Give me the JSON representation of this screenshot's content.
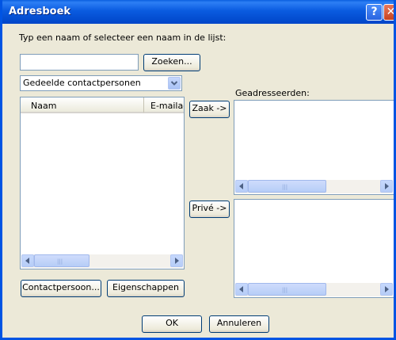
{
  "window": {
    "title": "Adresboek",
    "help_label": "?",
    "close_label": "✕"
  },
  "search": {
    "prompt": "Typ een naam of selecteer een naam in de lijst:",
    "value": "",
    "find_button": "Zoeken..."
  },
  "address_source": {
    "selected": "Gedeelde contactpersonen"
  },
  "contacts_list": {
    "columns": [
      "Naam",
      "E-mailad"
    ],
    "rows": []
  },
  "recipients": {
    "label": "Geadresseerden:",
    "to_button": "Zaak ->",
    "cc_button": "Privé ->"
  },
  "buttons": {
    "contact": "Contactpersoon...",
    "properties": "Eigenschappen",
    "ok": "OK",
    "cancel": "Annuleren"
  },
  "colors": {
    "titlebar": "#0054e3",
    "dialog_bg": "#ece9d8",
    "field_border": "#7f9db9",
    "button_border": "#003c74"
  },
  "icons": {
    "help": "question-mark",
    "close": "x",
    "dropdown": "chevron-down",
    "scroll_left": "triangle-left",
    "scroll_right": "triangle-right"
  }
}
